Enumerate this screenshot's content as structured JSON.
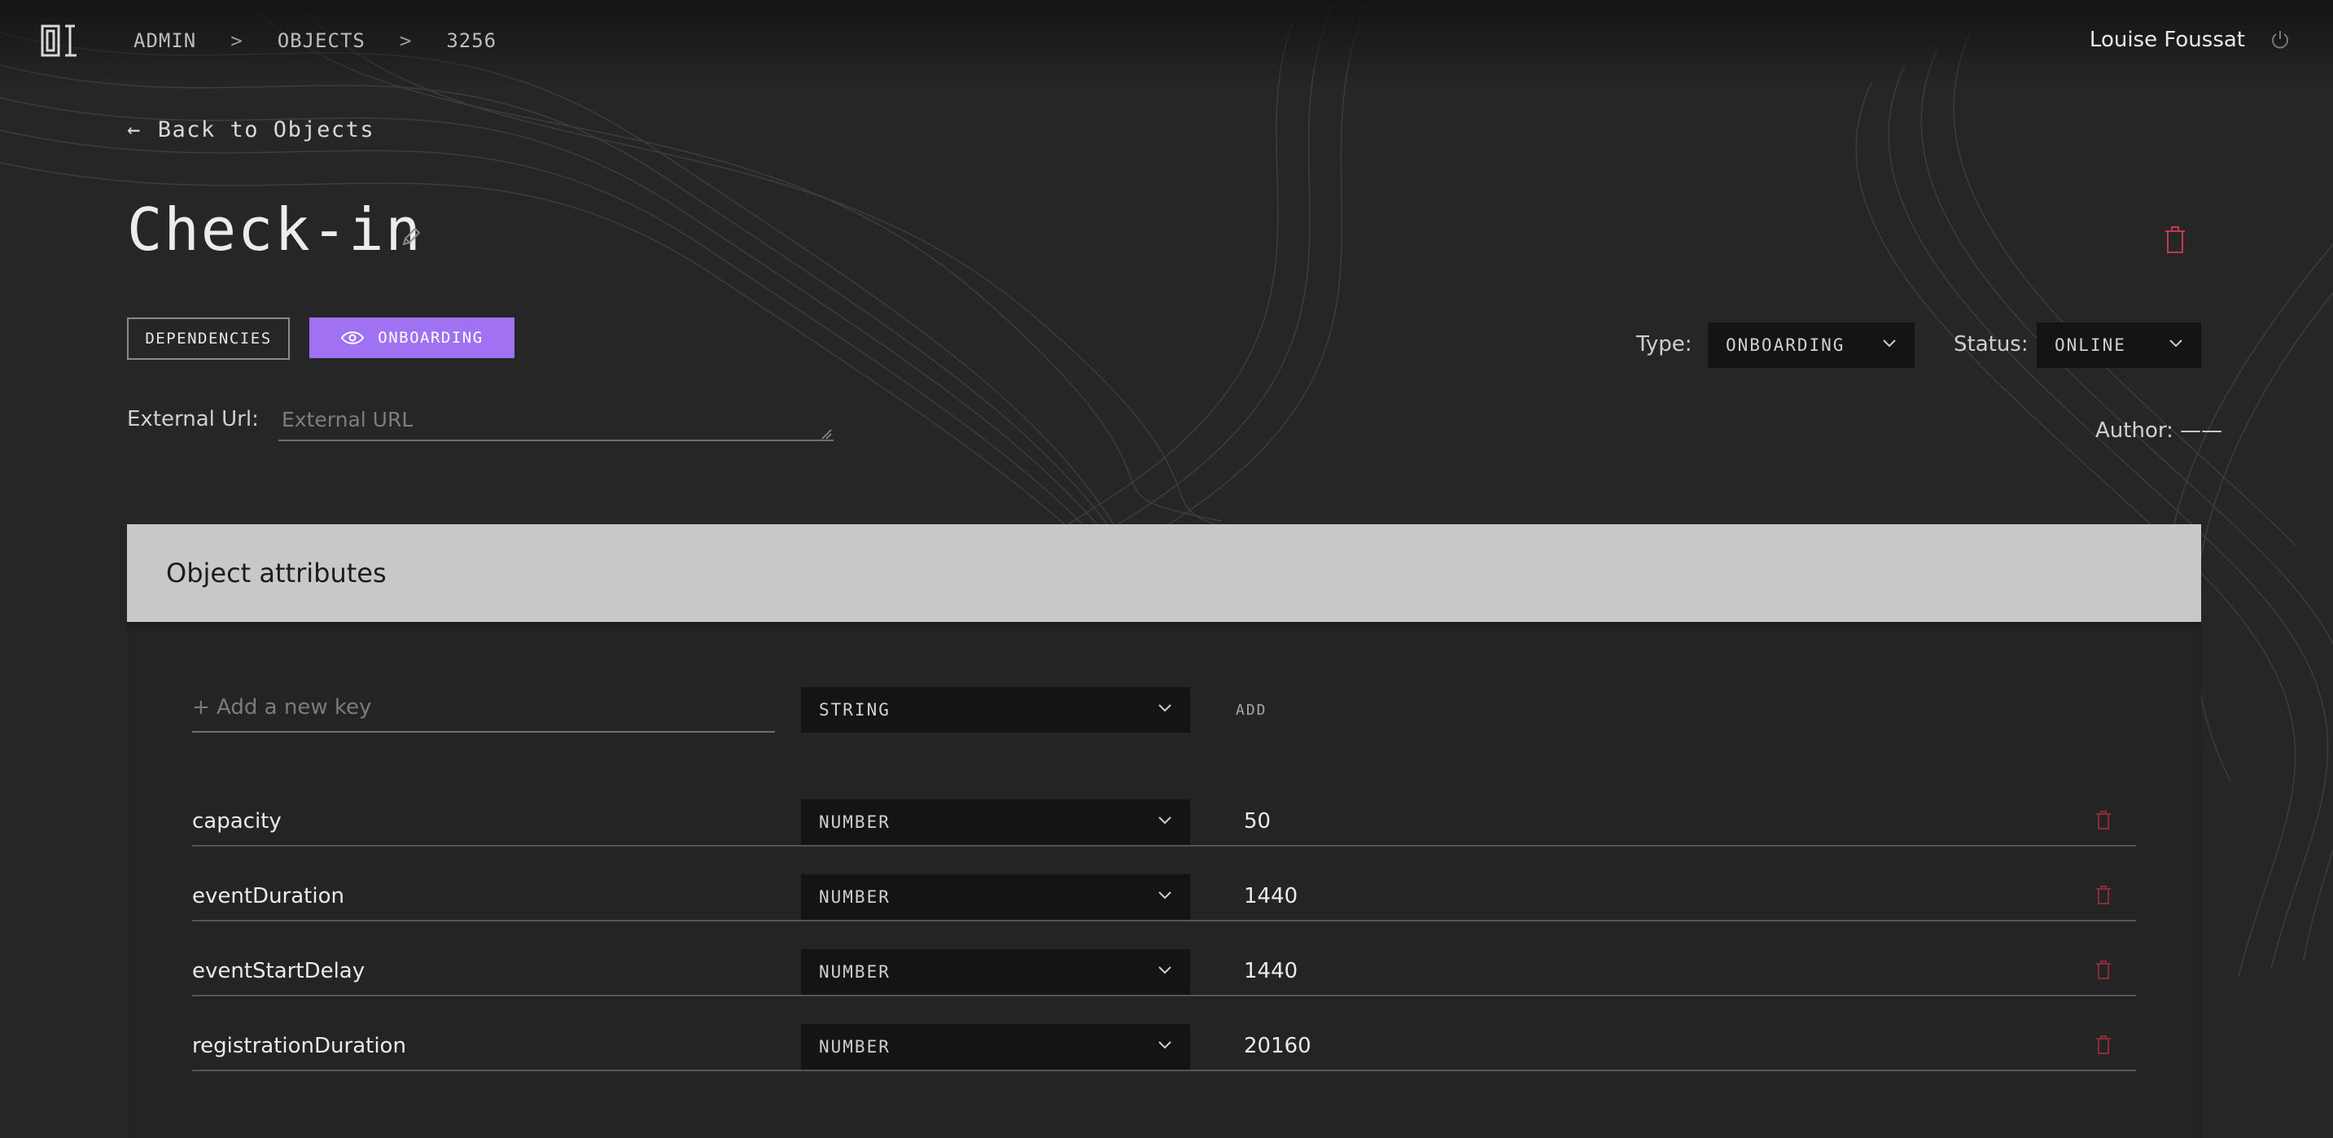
{
  "header": {
    "breadcrumbs": [
      "ADMIN",
      "OBJECTS",
      "3256"
    ],
    "separator": ">",
    "user_name": "Louise Foussat"
  },
  "back_link": {
    "arrow": "←",
    "label": "Back to Objects"
  },
  "object": {
    "title": "Check-in",
    "buttons": {
      "dependencies": "DEPENDENCIES",
      "onboarding": "ONBOARDING"
    },
    "type_label": "Type:",
    "type_value": "ONBOARDING",
    "status_label": "Status:",
    "status_value": "ONLINE",
    "external_url_label": "External Url:",
    "external_url_value": "",
    "external_url_placeholder": "External URL",
    "author_label": "Author:",
    "author_value": "——"
  },
  "attributes": {
    "title": "Object attributes",
    "new_key_placeholder": "+ Add a new key",
    "new_key_type": "STRING",
    "add_label": "ADD",
    "rows": [
      {
        "key": "capacity",
        "type": "NUMBER",
        "value": "50"
      },
      {
        "key": "eventDuration",
        "type": "NUMBER",
        "value": "1440"
      },
      {
        "key": "eventStartDelay",
        "type": "NUMBER",
        "value": "1440"
      },
      {
        "key": "registrationDuration",
        "type": "NUMBER",
        "value": "20160"
      }
    ]
  },
  "icons": {
    "logo": "logo-01-icon",
    "power": "power-icon",
    "edit": "pencil-icon",
    "delete": "trash-icon",
    "eye": "eye-icon",
    "dropdown": "chevron-down-icon"
  },
  "colors": {
    "background": "#262626",
    "accent": "#a171f3",
    "danger": "#c0394f",
    "panel_header": "#c8c8c8"
  }
}
